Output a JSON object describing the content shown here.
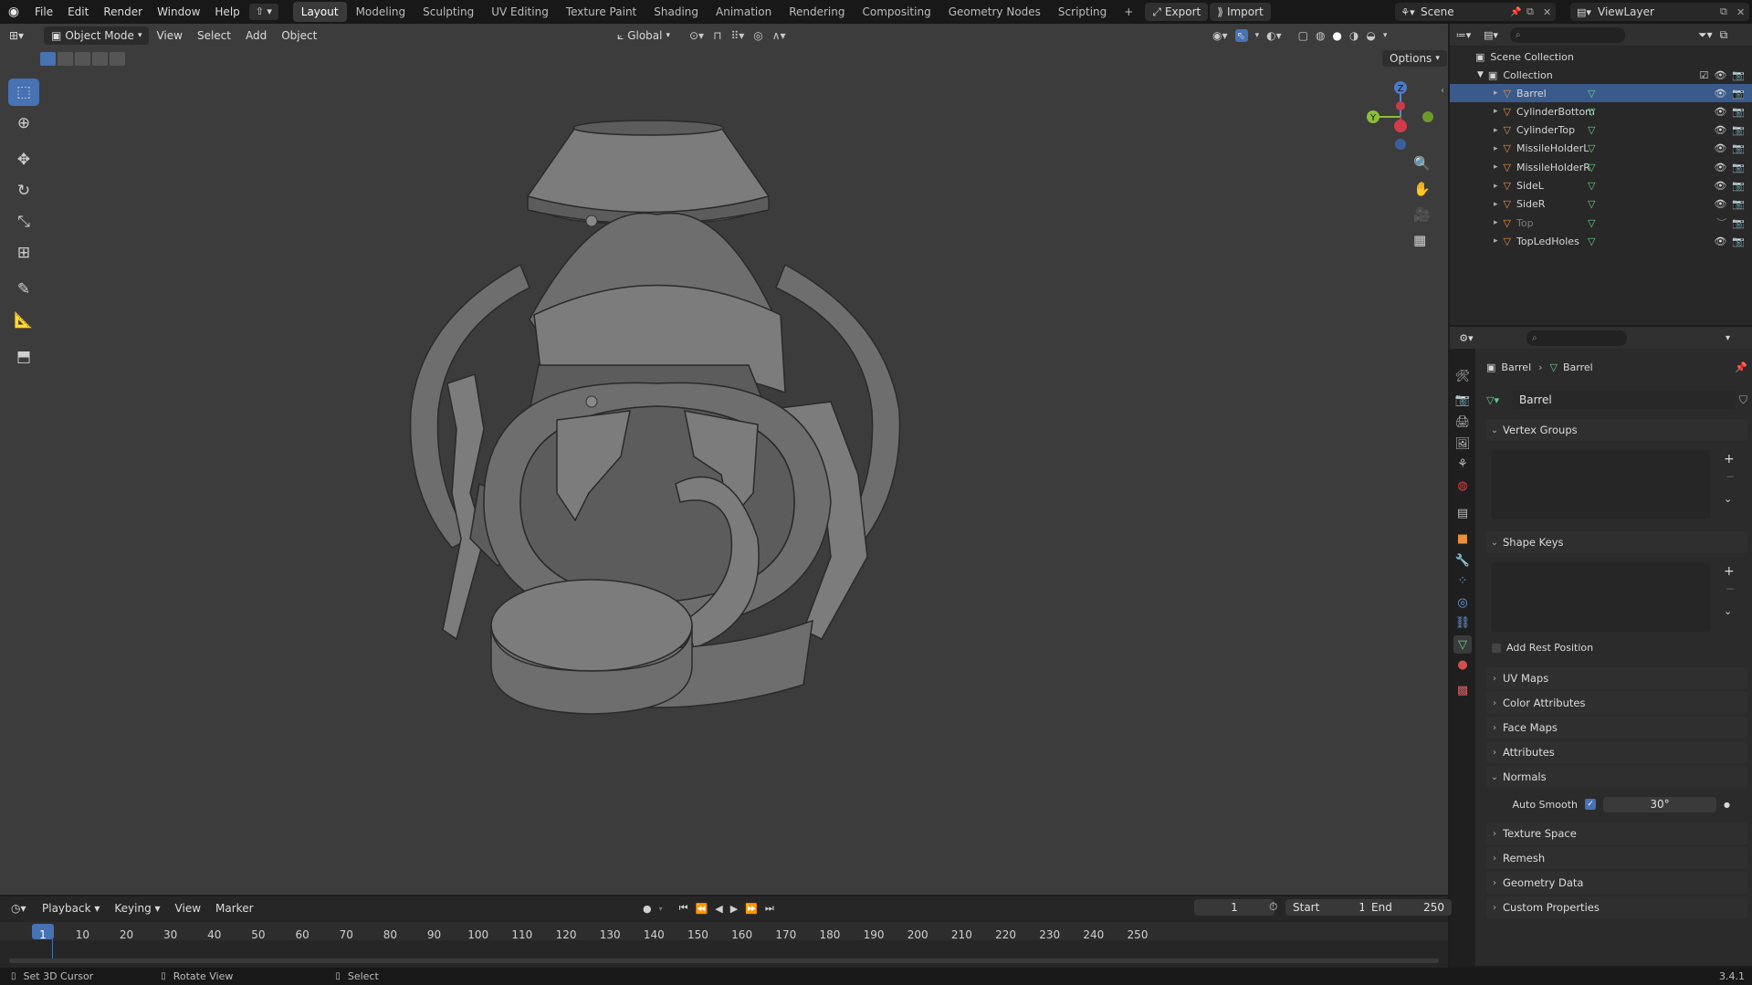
{
  "topbar": {
    "menus": [
      "File",
      "Edit",
      "Render",
      "Window",
      "Help"
    ],
    "workspaces": [
      "Layout",
      "Modeling",
      "Sculpting",
      "UV Editing",
      "Texture Paint",
      "Shading",
      "Animation",
      "Rendering",
      "Compositing",
      "Geometry Nodes",
      "Scripting"
    ],
    "active_workspace": "Layout",
    "export_label": "Export",
    "import_label": "Import",
    "scene_name": "Scene",
    "view_layer": "ViewLayer"
  },
  "viewport_header": {
    "mode": "Object Mode",
    "menus": [
      "View",
      "Select",
      "Add",
      "Object"
    ],
    "orientation": "Global",
    "options_label": "Options"
  },
  "gizmo": {
    "z": "Z",
    "y": "Y"
  },
  "outliner": {
    "root": "Scene Collection",
    "collection": "Collection",
    "objects": [
      {
        "name": "Barrel",
        "selected": true,
        "hidden": false
      },
      {
        "name": "CylinderBottom",
        "selected": false,
        "hidden": false
      },
      {
        "name": "CylinderTop",
        "selected": false,
        "hidden": false
      },
      {
        "name": "MissileHolderL",
        "selected": false,
        "hidden": false
      },
      {
        "name": "MissileHolderR",
        "selected": false,
        "hidden": false
      },
      {
        "name": "SideL",
        "selected": false,
        "hidden": false
      },
      {
        "name": "SideR",
        "selected": false,
        "hidden": false
      },
      {
        "name": "Top",
        "selected": false,
        "hidden": true
      },
      {
        "name": "TopLedHoles",
        "selected": false,
        "hidden": false
      }
    ]
  },
  "properties": {
    "breadcrumb_object": "Barrel",
    "breadcrumb_data": "Barrel",
    "data_name": "Barrel",
    "vertex_groups_label": "Vertex Groups",
    "shape_keys_label": "Shape Keys",
    "add_rest_position_label": "Add Rest Position",
    "panels": [
      "UV Maps",
      "Color Attributes",
      "Face Maps",
      "Attributes"
    ],
    "normals_label": "Normals",
    "auto_smooth_label": "Auto Smooth",
    "auto_smooth_angle": "30°",
    "panels_after": [
      "Texture Space",
      "Remesh",
      "Geometry Data",
      "Custom Properties"
    ]
  },
  "timeline": {
    "menus": [
      "Playback",
      "Keying",
      "View",
      "Marker"
    ],
    "current_frame": "1",
    "start_label": "Start",
    "start_value": "1",
    "end_label": "End",
    "end_value": "250",
    "ticks": [
      "1",
      "10",
      "20",
      "30",
      "40",
      "50",
      "60",
      "70",
      "80",
      "90",
      "100",
      "110",
      "120",
      "130",
      "140",
      "150",
      "160",
      "170",
      "180",
      "190",
      "200",
      "210",
      "220",
      "230",
      "240",
      "250"
    ]
  },
  "statusbar": {
    "hint1": "Set 3D Cursor",
    "hint2": "Rotate View",
    "hint3": "Select",
    "version": "3.4.1"
  },
  "colors": {
    "accent": "#4772b3",
    "selected_row": "#3b5a8c",
    "viewport_bg": "#3c3c3c"
  }
}
